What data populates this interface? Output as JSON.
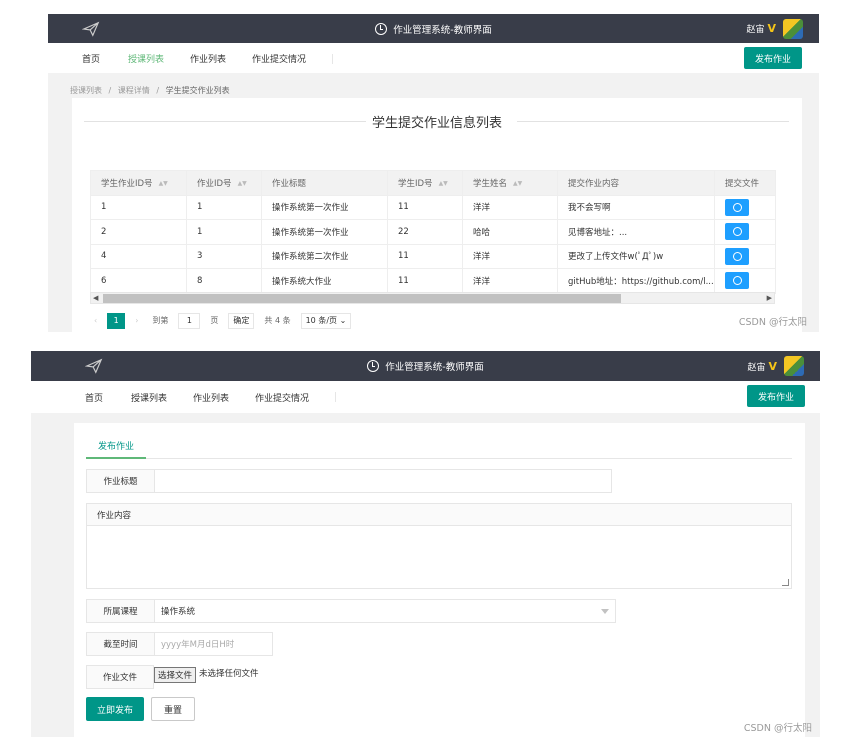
{
  "header": {
    "app_title": "作业管理系统-教师界面",
    "user_name": "赵宙",
    "user_badge": "V"
  },
  "nav": {
    "items": [
      "首页",
      "授课列表",
      "作业列表",
      "作业提交情况"
    ],
    "publish_button": "发布作业"
  },
  "screen1": {
    "breadcrumb": [
      "授课列表",
      "课程详情",
      "学生提交作业列表"
    ],
    "breadcrumb_sep": "/",
    "panel_title": "学生提交作业信息列表",
    "table": {
      "columns": [
        "学生作业ID号",
        "作业ID号",
        "作业标题",
        "学生ID号",
        "学生姓名",
        "提交作业内容",
        "提交文件"
      ],
      "rows": [
        [
          "1",
          "1",
          "操作系统第一次作业",
          "11",
          "洋洋",
          "我不会写啊"
        ],
        [
          "2",
          "1",
          "操作系统第一次作业",
          "22",
          "哈哈",
          "见博客地址：..."
        ],
        [
          "4",
          "3",
          "操作系统第二次作业",
          "11",
          "洋洋",
          "更改了上传文件w(ﾟДﾟ)w"
        ],
        [
          "6",
          "8",
          "操作系统大作业",
          "11",
          "洋洋",
          "gitHub地址：https://github.com/l..."
        ]
      ]
    },
    "pager": {
      "prev": "‹",
      "current": "1",
      "next": "›",
      "goto_label": "到第",
      "goto_value": "1",
      "page_unit": "页",
      "confirm": "确定",
      "total": "共 4 条",
      "page_size": "10 条/页"
    },
    "watermark": "CSDN @行太阳"
  },
  "screen2": {
    "tab": "发布作业",
    "form": {
      "title_label": "作业标题",
      "title_value": "",
      "content_label": "作业内容",
      "course_label": "所属课程",
      "course_value": "操作系统",
      "deadline_label": "截至时间",
      "deadline_placeholder": "yyyy年M月d日H时",
      "file_label": "作业文件",
      "file_button": "选择文件",
      "file_status": "未选择任何文件"
    },
    "submit_button": "立即发布",
    "reset_button": "重置",
    "watermark": "CSDN @行太阳"
  },
  "colors": {
    "topbar": "#393d49",
    "primary": "#009688",
    "active_nav": "#5fb878",
    "download": "#1e9fff"
  }
}
